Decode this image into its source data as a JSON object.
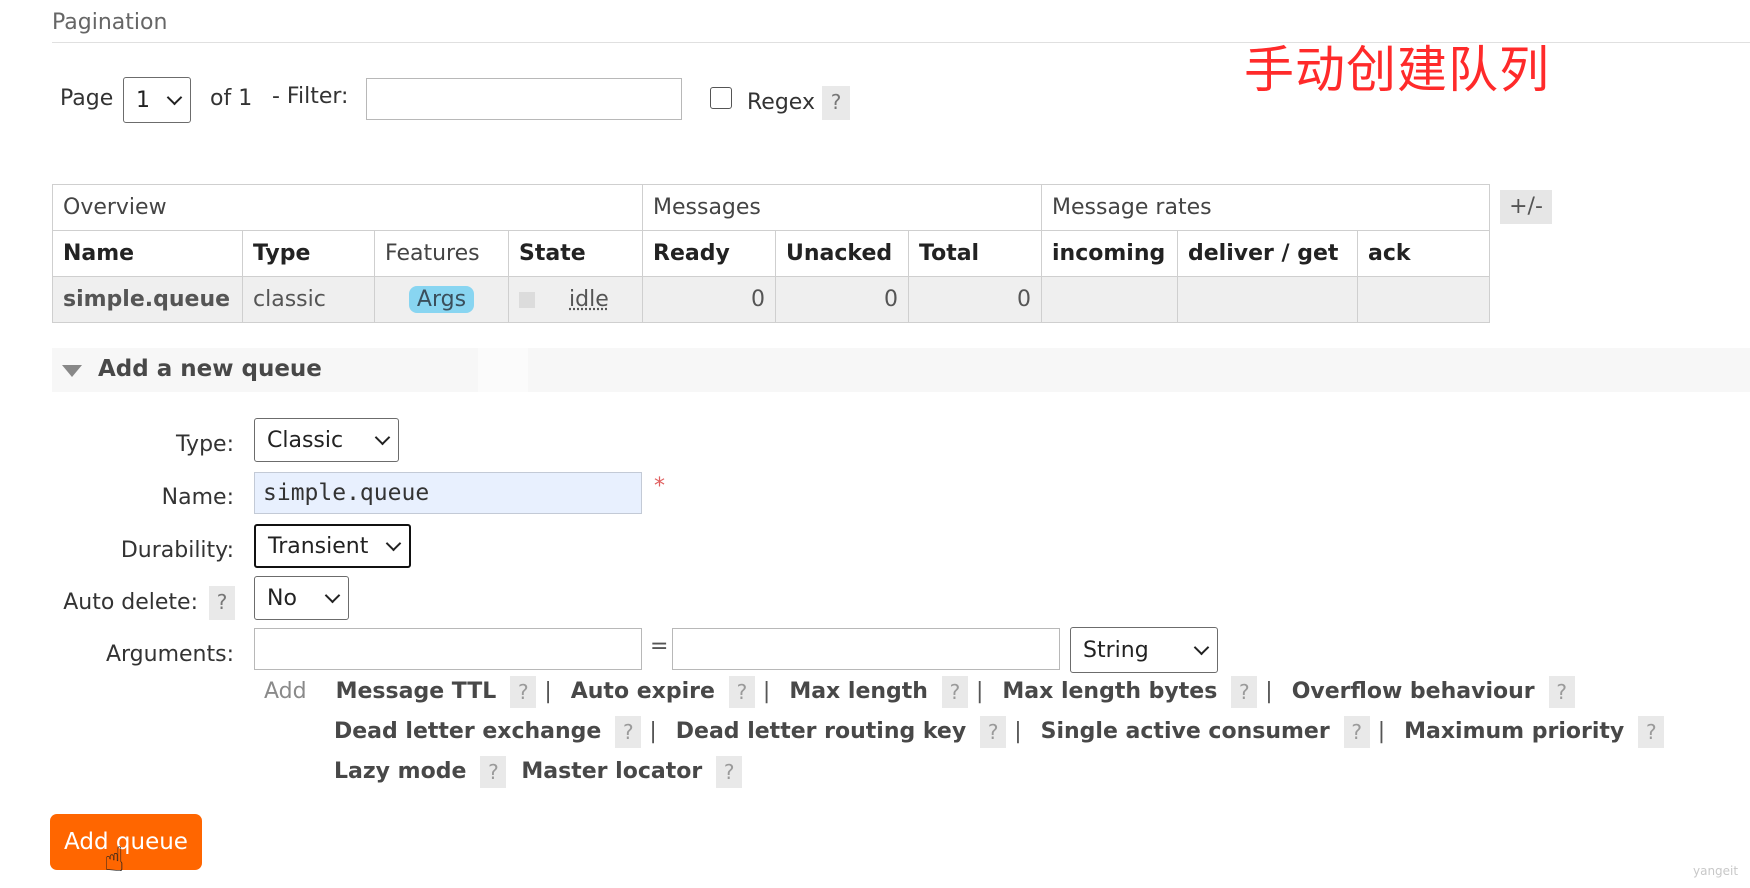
{
  "pagination": {
    "section_title": "Pagination",
    "page_label": "Page",
    "page_value": "1",
    "of_label": "of 1",
    "filter_label": "- Filter:",
    "filter_value": "",
    "regex_label": "Regex",
    "help": "?"
  },
  "annotation": "手动创建队列",
  "table": {
    "groups": [
      "Overview",
      "Messages",
      "Message rates"
    ],
    "columns": [
      "Name",
      "Type",
      "Features",
      "State",
      "Ready",
      "Unacked",
      "Total",
      "incoming",
      "deliver / get",
      "ack"
    ],
    "toggle": "+/-",
    "rows": [
      {
        "name": "simple.queue",
        "type": "classic",
        "features": "Args",
        "state": "idle",
        "ready": "0",
        "unacked": "0",
        "total": "0",
        "incoming": "",
        "deliver_get": "",
        "ack": ""
      }
    ]
  },
  "add_queue": {
    "heading": "Add a new queue",
    "type_label": "Type:",
    "type_value": "Classic",
    "name_label": "Name:",
    "name_value": "simple.queue",
    "required_mark": "*",
    "durability_label": "Durability:",
    "durability_value": "Transient",
    "auto_delete_label": "Auto delete:",
    "auto_delete_value": "No",
    "arguments_label": "Arguments:",
    "arg_key": "",
    "equals": "=",
    "arg_value": "",
    "arg_type": "String",
    "add_label": "Add",
    "quick_args": [
      "Message TTL",
      "Auto expire",
      "Max length",
      "Max length bytes",
      "Overflow behaviour",
      "Dead letter exchange",
      "Dead letter routing key",
      "Single active consumer",
      "Maximum priority",
      "Lazy mode",
      "Master locator"
    ],
    "submit": "Add queue"
  },
  "watermark": "yangeit",
  "colors": {
    "accent": "#ff6600",
    "args_pill": "#88d5f1",
    "annotation": "#ff2a2a"
  }
}
